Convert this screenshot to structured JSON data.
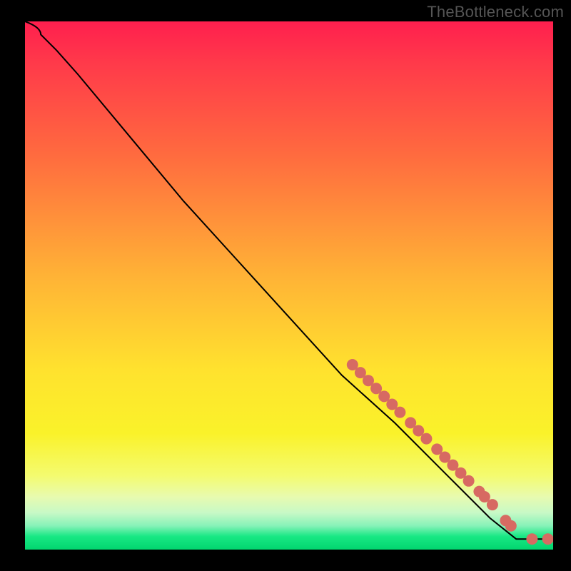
{
  "watermark": "TheBottleneck.com",
  "chart_data": {
    "type": "line",
    "title": "",
    "xlabel": "",
    "ylabel": "",
    "xlim": [
      0,
      100
    ],
    "ylim": [
      0,
      100
    ],
    "curve": [
      {
        "x": 0,
        "y": 100
      },
      {
        "x": 3,
        "y": 97.5
      },
      {
        "x": 6,
        "y": 94.5
      },
      {
        "x": 10,
        "y": 90
      },
      {
        "x": 20,
        "y": 78
      },
      {
        "x": 30,
        "y": 66
      },
      {
        "x": 40,
        "y": 55
      },
      {
        "x": 50,
        "y": 44
      },
      {
        "x": 60,
        "y": 33
      },
      {
        "x": 70,
        "y": 24
      },
      {
        "x": 80,
        "y": 14
      },
      {
        "x": 88,
        "y": 6
      },
      {
        "x": 93,
        "y": 2
      },
      {
        "x": 96,
        "y": 2
      },
      {
        "x": 100,
        "y": 2
      }
    ],
    "series": [
      {
        "name": "markers",
        "points": [
          {
            "x": 62,
            "y": 35
          },
          {
            "x": 63.5,
            "y": 33.5
          },
          {
            "x": 65,
            "y": 32
          },
          {
            "x": 66.5,
            "y": 30.5
          },
          {
            "x": 68,
            "y": 29
          },
          {
            "x": 69.5,
            "y": 27.5
          },
          {
            "x": 71,
            "y": 26
          },
          {
            "x": 73,
            "y": 24
          },
          {
            "x": 74.5,
            "y": 22.5
          },
          {
            "x": 76,
            "y": 21
          },
          {
            "x": 78,
            "y": 19
          },
          {
            "x": 79.5,
            "y": 17.5
          },
          {
            "x": 81,
            "y": 16
          },
          {
            "x": 82.5,
            "y": 14.5
          },
          {
            "x": 84,
            "y": 13
          },
          {
            "x": 86,
            "y": 11
          },
          {
            "x": 87,
            "y": 10
          },
          {
            "x": 88.5,
            "y": 8.5
          },
          {
            "x": 91,
            "y": 5.5
          },
          {
            "x": 92,
            "y": 4.5
          },
          {
            "x": 96,
            "y": 2
          },
          {
            "x": 99,
            "y": 2
          }
        ]
      }
    ],
    "colors": {
      "curve": "#000000",
      "marker": "#d76a62",
      "gradient_top": "#ff1f4e",
      "gradient_mid": "#ffe22e",
      "gradient_bottom": "#02d66f"
    }
  }
}
